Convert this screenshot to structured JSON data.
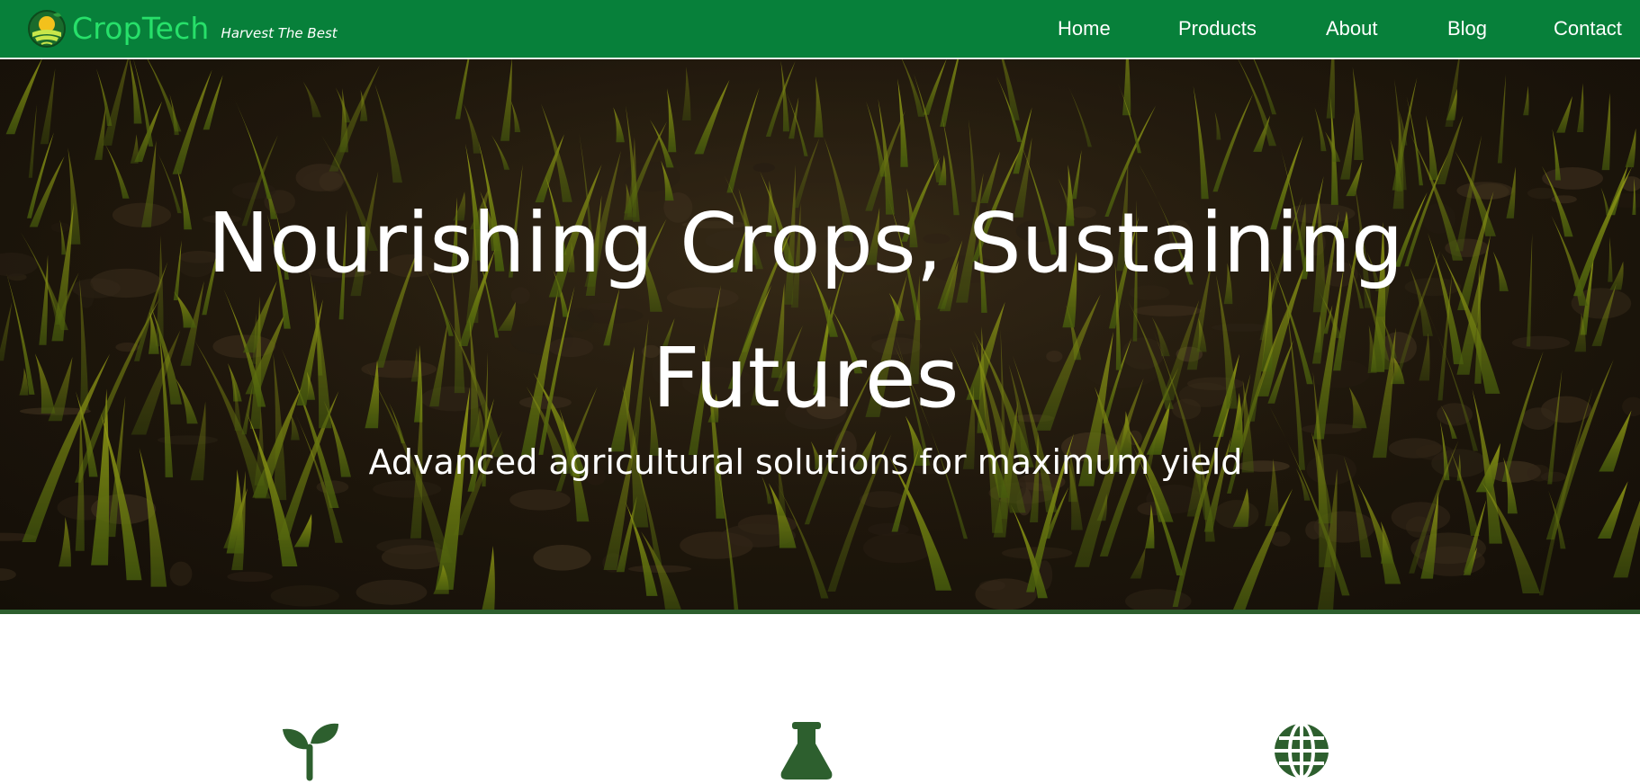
{
  "brand": {
    "name": "CropTech",
    "tagline": "Harvest The Best",
    "logo_icon": "sun-over-field-logo-icon"
  },
  "nav": {
    "items": [
      {
        "label": "Home"
      },
      {
        "label": "Products"
      },
      {
        "label": "About"
      },
      {
        "label": "Blog"
      },
      {
        "label": "Contact"
      }
    ]
  },
  "hero": {
    "title": "Nourishing Crops, Sustaining Futures",
    "subtitle": "Advanced agricultural solutions for maximum yield",
    "background": "seedlings-in-soil-photo"
  },
  "features": {
    "icons": [
      "seedling-icon",
      "flask-icon",
      "globe-icon"
    ]
  },
  "colors": {
    "nav_background": "#07803a",
    "brand_text": "#27e06a",
    "hero_border": "#2d5f2e",
    "feature_icon": "#2d5f2e"
  }
}
